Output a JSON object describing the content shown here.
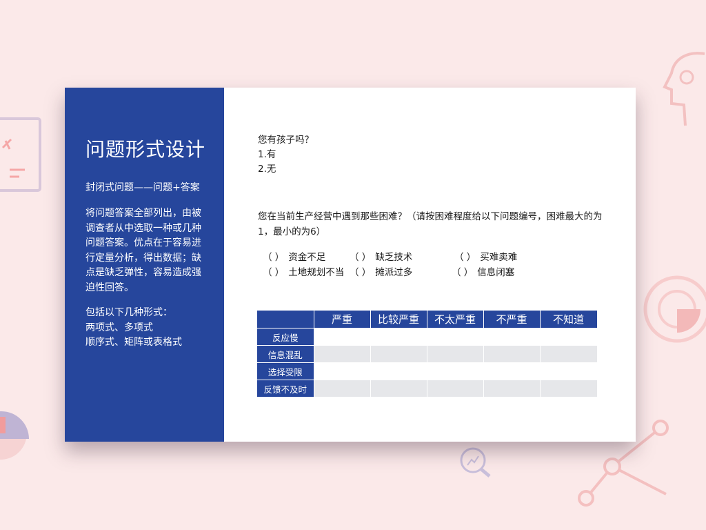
{
  "sidebar": {
    "title": "问题形式设计",
    "subtitle": "封闭式问题——问题+答案",
    "description": "将问题答案全部列出，由被调查者从中选取一种或几种问题答案。优点在于容易进行定量分析，得出数据；缺点是缺乏弹性，容易造成强迫性回答。",
    "forms": [
      "包括以下几种形式：",
      "两项式、多项式",
      "顺序式、矩阵或表格式"
    ]
  },
  "question1": {
    "text": "您有孩子吗？",
    "options": [
      "1.有",
      "2.无"
    ]
  },
  "question2": {
    "text": "您在当前生产经营中遇到那些困难？（请按困难程度给以下问题编号，困难最大的为1，最小的为6）",
    "bracket": "（ ）",
    "options": [
      "资金不足",
      "缺乏技术",
      "买难卖难",
      "土地规划不当",
      "摊派过多",
      "信息闭塞"
    ]
  },
  "matrix": {
    "columns": [
      "",
      "严重",
      "比较严重",
      "不太严重",
      "不严重",
      "不知道"
    ],
    "rows": [
      "反应慢",
      "信息混乱",
      "选择受限",
      "反馈不及时"
    ]
  },
  "colors": {
    "primary": "#26469c",
    "background": "#fbe9e9",
    "stripe": "#e6e7ea",
    "decor": "#f2b6b6"
  }
}
